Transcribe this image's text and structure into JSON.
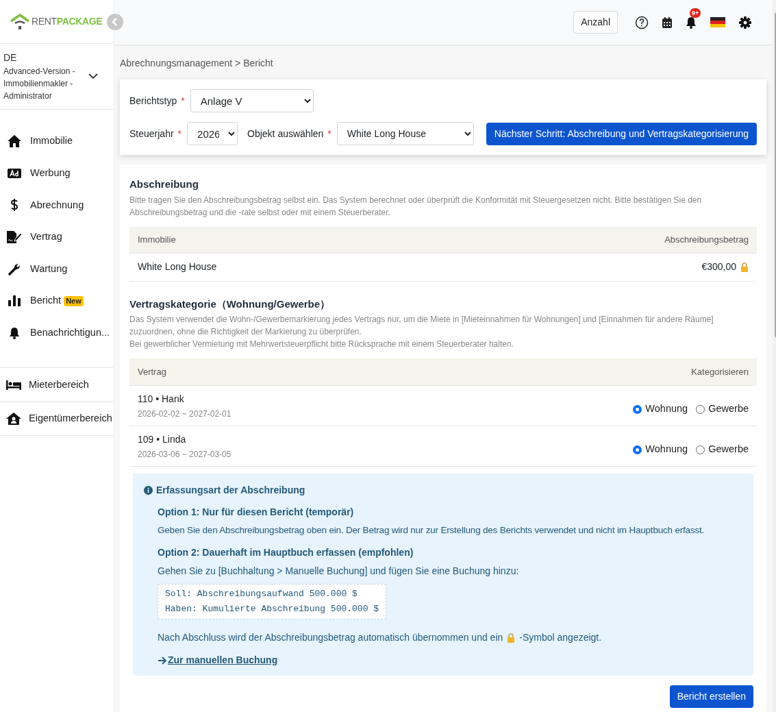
{
  "logo": {
    "part_1": "RENT",
    "part_2": "PACKAGE"
  },
  "header": {
    "count_button": "Anzahl",
    "notification_badge": "9+"
  },
  "account": {
    "region": "DE",
    "role": "Advanced-Version - Immobilienmakler - Administrator"
  },
  "sidebar": {
    "items": [
      {
        "label": "Immobilie"
      },
      {
        "label": "Werbung"
      },
      {
        "label": "Abrechnung"
      },
      {
        "label": "Vertrag"
      },
      {
        "label": "Wartung"
      },
      {
        "label": "Bericht",
        "badge": "New"
      },
      {
        "label": "Benachrichtigun..."
      }
    ],
    "areas": [
      {
        "label": "Mieterbereich"
      },
      {
        "label": "Eigentümerbereich"
      }
    ]
  },
  "breadcrumb": "Abrechnungsmanagement > Bericht",
  "form": {
    "report_type": {
      "label": "Berichtstyp",
      "required": "*",
      "value": "Anlage V"
    },
    "tax_year": {
      "label": "Steuerjahr",
      "required": "*",
      "value": "2026"
    },
    "object": {
      "label": "Objekt auswählen",
      "required": "*",
      "value": "White Long House"
    },
    "next_button": "Nächster Schritt: Abschreibung und Vertragskategorisierung"
  },
  "depreciation": {
    "title": "Abschreibung",
    "note": "Bitte tragen Sie den Abschreibungsbetrag selbst ein. Das System berechnet oder überprüft die Konformität mit Steuergesetzen nicht. Bitte bestätigen Sie den Abschreibungsbetrag und die -rate selbst oder mit einem Steuerberater.",
    "columns": [
      "Immobilie",
      "Abschreibungsbetrag"
    ],
    "rows": [
      {
        "property": "White Long House",
        "amount": "€300,00",
        "locked": true
      }
    ]
  },
  "contract_category": {
    "title": "Vertragskategorie（Wohnung/Gewerbe）",
    "notes": [
      "Das System verwendet die Wohn-/Gewerbemarkierung jedes Vertrags nur, um die Miete in [Mieteinnahmen für Wohnungen] und [Einnahmen für andere Räume] zuzuordnen, ohne die Richtigkeit der Markierung zu überprüfen.",
      "Bei gewerblicher Vermietung mit Mehrwertsteuerpflicht bitte Rücksprache mit einem Steuerberater halten."
    ],
    "columns": [
      "Vertrag",
      "Kategorisieren"
    ],
    "rows": [
      {
        "contract": "110 • Hank",
        "period": "2026-02-02 ~ 2027-02-01",
        "options": [
          {
            "label": "Wohnung",
            "selected": true
          },
          {
            "label": "Gewerbe",
            "selected": false
          }
        ]
      },
      {
        "contract": "109 • Linda",
        "period": "2026-03-06 ~ 2027-03-05",
        "options": [
          {
            "label": "Wohnung",
            "selected": true
          },
          {
            "label": "Gewerbe",
            "selected": false
          }
        ]
      }
    ]
  },
  "info": {
    "title": "Erfassungsart der Abschreibung",
    "option_1": {
      "title": "Option 1: Nur für diesen Bericht (temporär)",
      "text": "Geben Sie den Abschreibungsbetrag oben ein. Der Betrag wird nur zur Erstellung des Berichts verwendet und nicht im Hauptbuch erfasst."
    },
    "option_2": {
      "title": "Option 2: Dauerhaft im Hauptbuch erfassen (empfohlen)",
      "text": "Gehen Sie zu [Buchhaltung > Manuelle Buchung] und fügen Sie eine Buchung hinzu:",
      "code": [
        "Soll: Abschreibungsaufwand 500.000 $",
        "Haben: Kumulierte Abschreibung 500.000 $"
      ]
    },
    "after_text_start": "Nach Abschluss wird der Abschreibungsbetrag automatisch übernommen und ein",
    "after_text_end": "-Symbol angezeigt.",
    "link": "Zur manuellen Buchung"
  },
  "submit_button": "Bericht erstellen"
}
